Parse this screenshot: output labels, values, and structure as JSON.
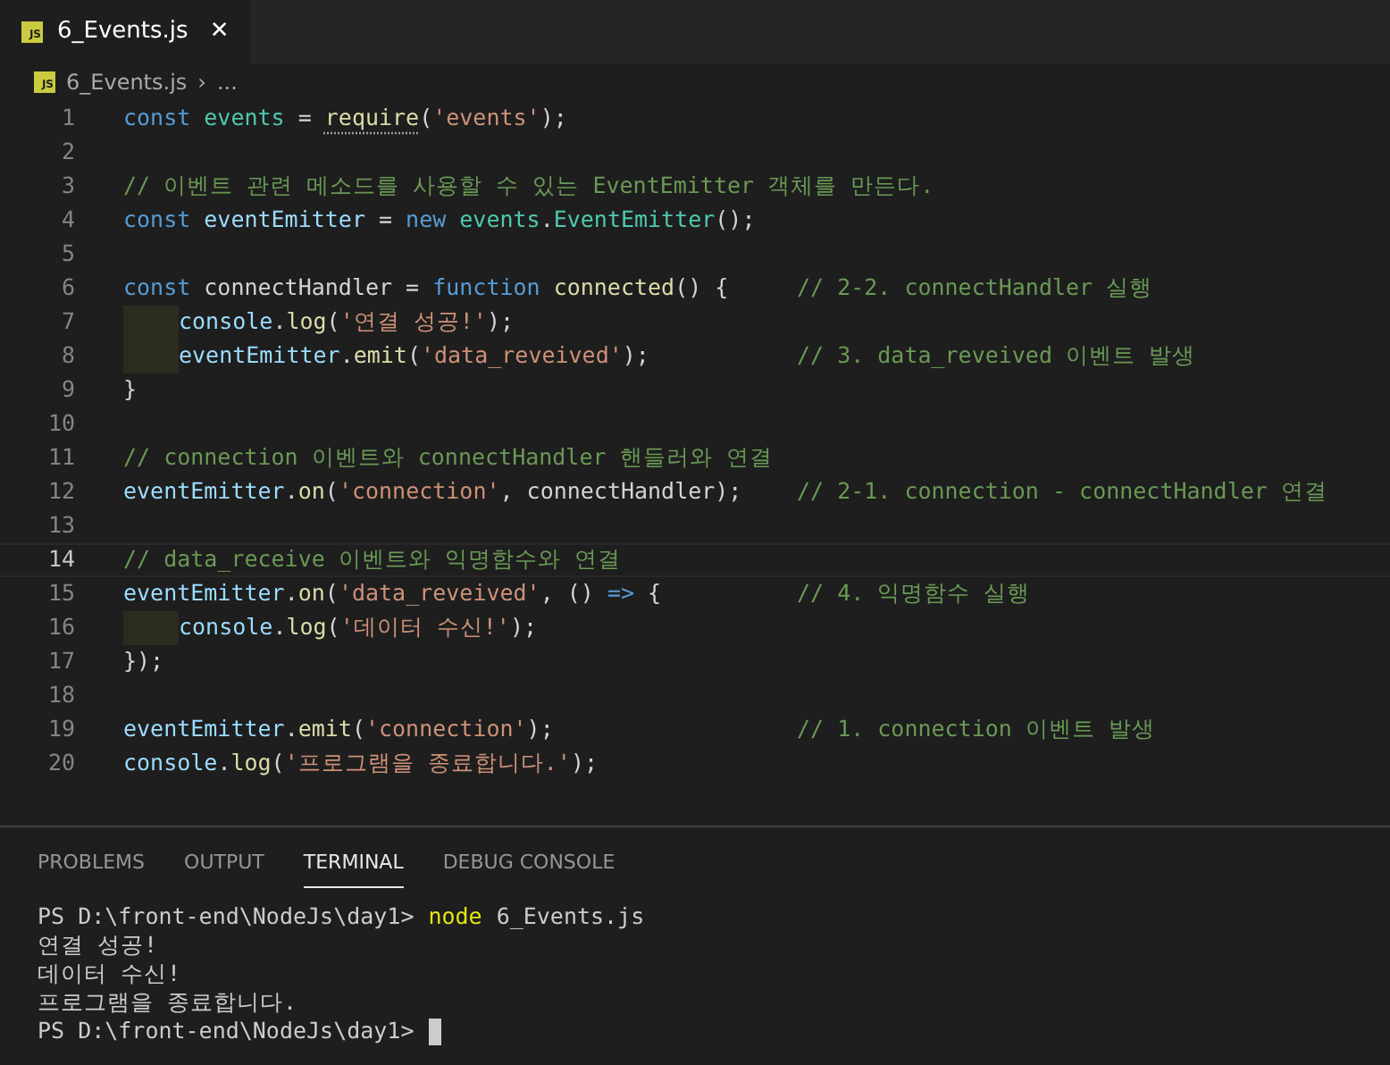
{
  "tabs": [
    {
      "label": "6_Events.js",
      "icon": "JS",
      "selected": true,
      "close": "✕"
    }
  ],
  "breadcrumb": {
    "icon": "JS",
    "file": "6_Events.js",
    "separator": "›",
    "rest": "..."
  },
  "editor": {
    "lines": [
      {
        "number": "1",
        "indented": false,
        "current": false,
        "tokens": [
          {
            "text": "const ",
            "kind": "kw"
          },
          {
            "text": "events",
            "kind": "cls"
          },
          {
            "text": " = ",
            "kind": "plain"
          },
          {
            "text": "require",
            "kind": "fn_hint"
          },
          {
            "text": "(",
            "kind": "plain"
          },
          {
            "text": "'events'",
            "kind": "str"
          },
          {
            "text": ");",
            "kind": "plain"
          }
        ]
      },
      {
        "number": "2",
        "indented": false,
        "current": false
      },
      {
        "number": "3",
        "indented": false,
        "current": false,
        "tokens": [
          {
            "text": "// 이벤트 관련 메소드를 사용할 수 있는 EventEmitter 객체를 만든다.",
            "kind": "cmt"
          }
        ]
      },
      {
        "number": "4",
        "indented": false,
        "current": false,
        "tokens": [
          {
            "text": "const ",
            "kind": "kw"
          },
          {
            "text": "eventEmitter",
            "kind": "var"
          },
          {
            "text": " = ",
            "kind": "plain"
          },
          {
            "text": "new ",
            "kind": "kw"
          },
          {
            "text": "events",
            "kind": "cls"
          },
          {
            "text": ".",
            "kind": "plain"
          },
          {
            "text": "EventEmitter",
            "kind": "cls"
          },
          {
            "text": "();",
            "kind": "plain"
          }
        ]
      },
      {
        "number": "5",
        "indented": false,
        "current": false
      },
      {
        "number": "6",
        "indented": false,
        "current": false,
        "tokens": [
          {
            "text": "const ",
            "kind": "kw"
          },
          {
            "text": "connectHandler = ",
            "kind": "plain"
          },
          {
            "text": "function ",
            "kind": "kw"
          },
          {
            "text": "connected",
            "kind": "fn"
          },
          {
            "text": "() {",
            "kind": "plain"
          }
        ],
        "comment": "// 2-2. connectHandler 실행"
      },
      {
        "number": "7",
        "indented": true,
        "current": false,
        "tokens": [
          {
            "text": "console",
            "kind": "var"
          },
          {
            "text": ".",
            "kind": "plain"
          },
          {
            "text": "log",
            "kind": "fn"
          },
          {
            "text": "(",
            "kind": "plain"
          },
          {
            "text": "'연결 성공!'",
            "kind": "str"
          },
          {
            "text": ");",
            "kind": "plain"
          }
        ]
      },
      {
        "number": "8",
        "indented": true,
        "current": false,
        "tokens": [
          {
            "text": "eventEmitter",
            "kind": "var"
          },
          {
            "text": ".",
            "kind": "plain"
          },
          {
            "text": "emit",
            "kind": "fn"
          },
          {
            "text": "(",
            "kind": "plain"
          },
          {
            "text": "'data_reveived'",
            "kind": "str"
          },
          {
            "text": ");",
            "kind": "plain"
          }
        ],
        "comment": "// 3. data_reveived 이벤트 발생"
      },
      {
        "number": "9",
        "indented": false,
        "current": false,
        "tokens": [
          {
            "text": "}",
            "kind": "plain"
          }
        ]
      },
      {
        "number": "10",
        "indented": false,
        "current": false
      },
      {
        "number": "11",
        "indented": false,
        "current": false,
        "tokens": [
          {
            "text": "// connection 이벤트와 connectHandler 핸들러와 연결",
            "kind": "cmt"
          }
        ]
      },
      {
        "number": "12",
        "indented": false,
        "current": false,
        "tokens": [
          {
            "text": "eventEmitter",
            "kind": "var"
          },
          {
            "text": ".",
            "kind": "plain"
          },
          {
            "text": "on",
            "kind": "fn"
          },
          {
            "text": "(",
            "kind": "plain"
          },
          {
            "text": "'connection'",
            "kind": "str"
          },
          {
            "text": ", connectHandler);",
            "kind": "plain"
          }
        ],
        "comment": "// 2-1. connection - connectHandler 연결"
      },
      {
        "number": "13",
        "indented": false,
        "current": false
      },
      {
        "number": "14",
        "indented": false,
        "current": true,
        "tokens": [
          {
            "text": "// data_receive 이벤트와 익명함수와 연결",
            "kind": "cmt"
          }
        ]
      },
      {
        "number": "15",
        "indented": false,
        "current": false,
        "tokens": [
          {
            "text": "eventEmitter",
            "kind": "var"
          },
          {
            "text": ".",
            "kind": "plain"
          },
          {
            "text": "on",
            "kind": "fn"
          },
          {
            "text": "(",
            "kind": "plain"
          },
          {
            "text": "'data_reveived'",
            "kind": "str"
          },
          {
            "text": ", () ",
            "kind": "plain"
          },
          {
            "text": "=>",
            "kind": "kw"
          },
          {
            "text": " {",
            "kind": "plain"
          }
        ],
        "comment": "// 4. 익명함수 실행"
      },
      {
        "number": "16",
        "indented": true,
        "current": false,
        "tokens": [
          {
            "text": "console",
            "kind": "var"
          },
          {
            "text": ".",
            "kind": "plain"
          },
          {
            "text": "log",
            "kind": "fn"
          },
          {
            "text": "(",
            "kind": "plain"
          },
          {
            "text": "'데이터 수신!'",
            "kind": "str"
          },
          {
            "text": ");",
            "kind": "plain"
          }
        ]
      },
      {
        "number": "17",
        "indented": false,
        "current": false,
        "tokens": [
          {
            "text": "});",
            "kind": "plain"
          }
        ]
      },
      {
        "number": "18",
        "indented": false,
        "current": false
      },
      {
        "number": "19",
        "indented": false,
        "current": false,
        "tokens": [
          {
            "text": "eventEmitter",
            "kind": "var"
          },
          {
            "text": ".",
            "kind": "plain"
          },
          {
            "text": "emit",
            "kind": "fn"
          },
          {
            "text": "(",
            "kind": "plain"
          },
          {
            "text": "'connection'",
            "kind": "str"
          },
          {
            "text": ");",
            "kind": "plain"
          }
        ],
        "comment": "// 1. connection 이벤트 발생"
      },
      {
        "number": "20",
        "indented": false,
        "current": false,
        "tokens": [
          {
            "text": "console",
            "kind": "var"
          },
          {
            "text": ".",
            "kind": "plain"
          },
          {
            "text": "log",
            "kind": "fn"
          },
          {
            "text": "(",
            "kind": "plain"
          },
          {
            "text": "'프로그램을 종료합니다.'",
            "kind": "str"
          },
          {
            "text": ");",
            "kind": "plain"
          }
        ]
      }
    ]
  },
  "panel": {
    "tabs": [
      {
        "label": "PROBLEMS",
        "selected": false
      },
      {
        "label": "OUTPUT",
        "selected": false
      },
      {
        "label": "TERMINAL",
        "selected": true
      },
      {
        "label": "DEBUG CONSOLE",
        "selected": false
      }
    ],
    "terminal": [
      {
        "kind": "prompt",
        "prompt": "PS D:\\front-end\\NodeJs\\day1>",
        "program": "node",
        "args": "6_Events.js",
        "cursor": false
      },
      {
        "kind": "output",
        "text": "연결 성공!"
      },
      {
        "kind": "output",
        "text": "데이터 수신!"
      },
      {
        "kind": "output",
        "text": "프로그램을 종료합니다."
      },
      {
        "kind": "prompt",
        "prompt": "PS D:\\front-end\\NodeJs\\day1>",
        "cursor": true
      }
    ]
  }
}
